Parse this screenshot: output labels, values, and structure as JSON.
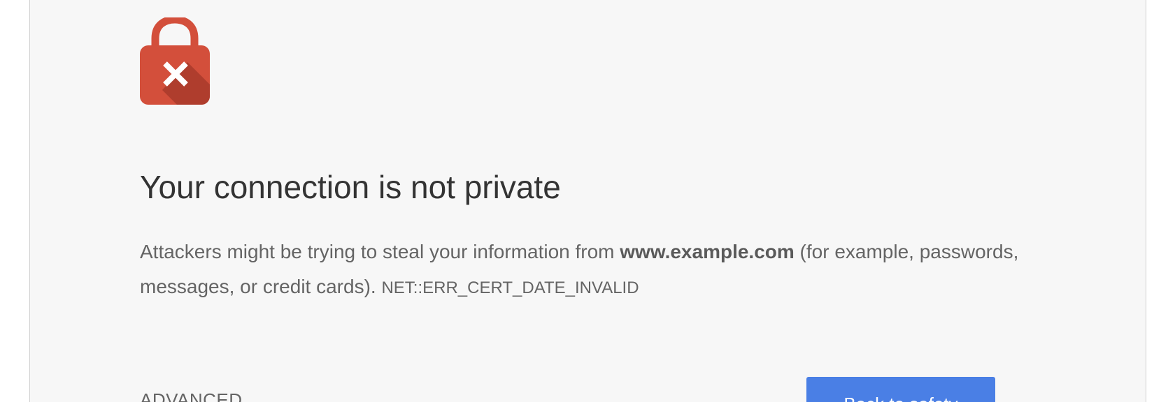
{
  "interstitial": {
    "heading": "Your connection is not private",
    "message_prefix": "Attackers might be trying to steal your information from ",
    "domain": "www.example.com",
    "message_suffix": " (for example, passwords, messages, or credit cards). ",
    "error_code": "NET::ERR_CERT_DATE_INVALID",
    "advanced_label": "ADVANCED",
    "primary_button_label": "Back to safety"
  },
  "icons": {
    "lock": "lock-error-icon"
  },
  "colors": {
    "lock_red": "#d34f3b",
    "lock_shadow": "#a83a2c",
    "button_blue": "#4a7fe5",
    "page_background": "#f7f7f7",
    "heading_text": "#333333",
    "body_text": "#646464"
  }
}
